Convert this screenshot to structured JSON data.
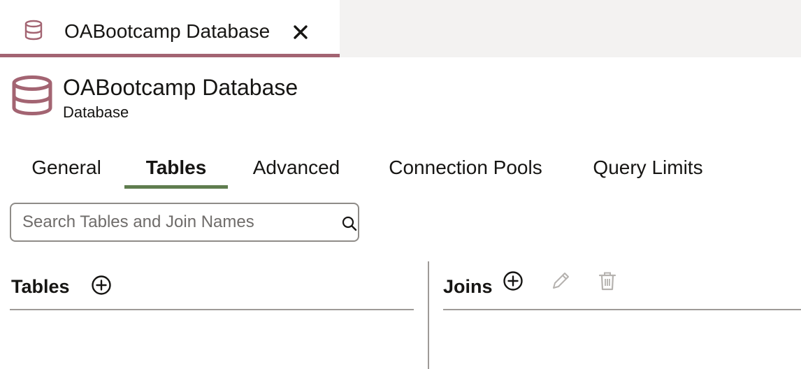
{
  "document_tab": {
    "icon": "database-icon",
    "title": "OABootcamp Database",
    "close_icon": "close-icon"
  },
  "header": {
    "icon": "database-icon",
    "title": "OABootcamp Database",
    "subtitle": "Database"
  },
  "tabs": [
    {
      "label": "General",
      "active": false
    },
    {
      "label": "Tables",
      "active": true
    },
    {
      "label": "Advanced",
      "active": false
    },
    {
      "label": "Connection Pools",
      "active": false
    },
    {
      "label": "Query Limits",
      "active": false
    }
  ],
  "search": {
    "placeholder": "Search Tables and Join Names",
    "value": "",
    "icon": "search-icon"
  },
  "tables_panel": {
    "heading": "Tables",
    "add_icon": "add-circle-icon"
  },
  "joins_panel": {
    "heading": "Joins",
    "add_icon": "add-circle-icon",
    "edit_icon": "pencil-icon",
    "delete_icon": "trash-icon"
  },
  "colors": {
    "accent_db": "#a36472",
    "active_tab_underline": "#5f7d4f",
    "tab_strip_bg": "#f3f2f1",
    "disabled_icon": "#b5b2af"
  }
}
